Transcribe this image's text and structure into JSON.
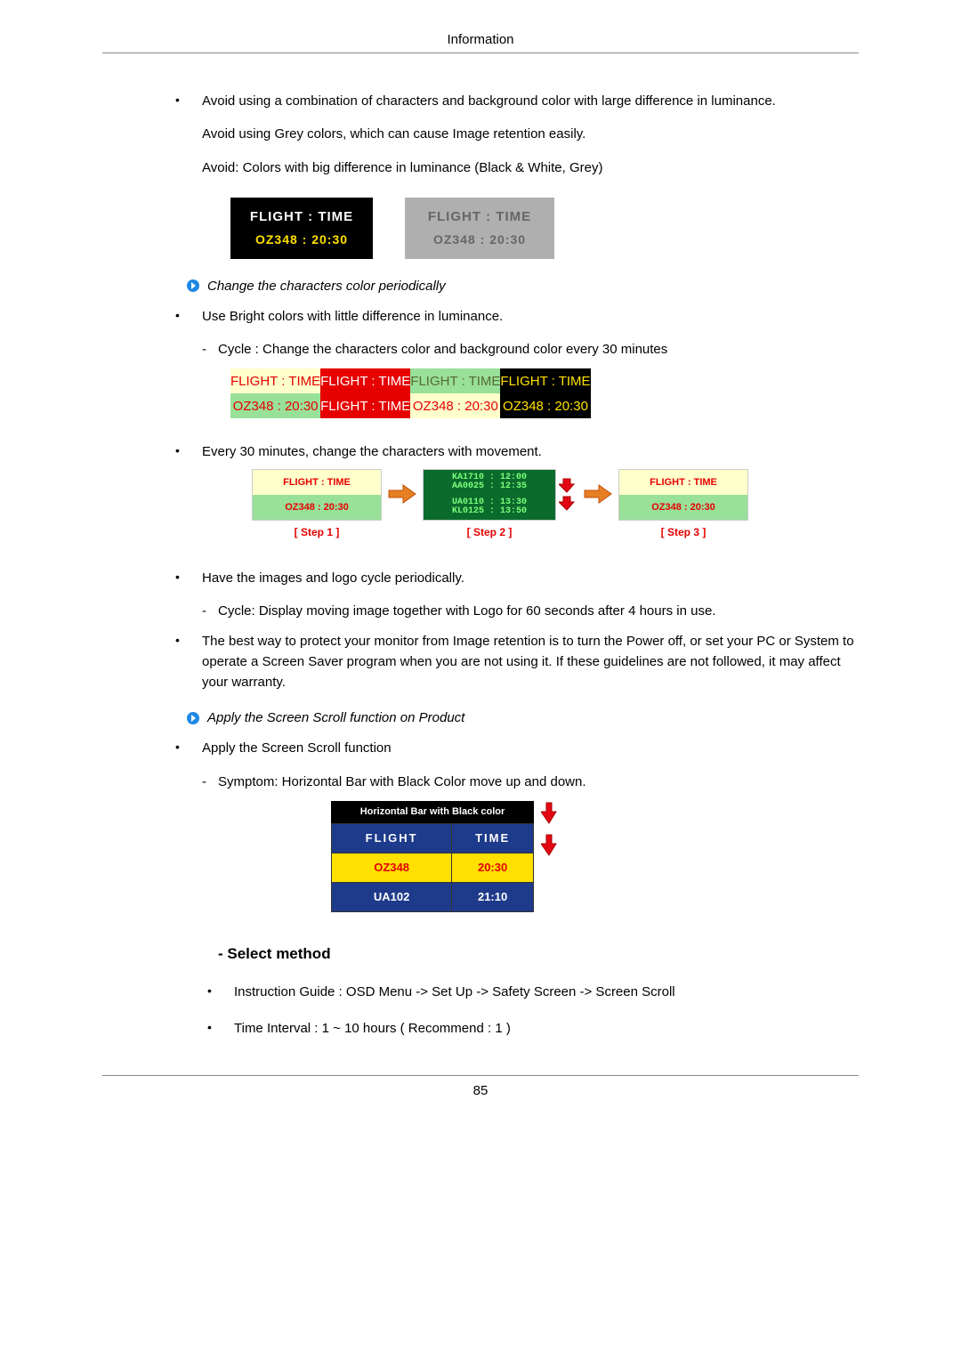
{
  "header": {
    "title": "Information"
  },
  "footer": {
    "page_number": "85"
  },
  "body": {
    "p1": "Avoid using a combination of characters and background color with large difference in luminance.",
    "p2": "Avoid using Grey colors, which can cause Image retention easily.",
    "p3": "Avoid: Colors with big difference in luminance (Black & White, Grey)",
    "fig1": {
      "a_row1": "FLIGHT : TIME",
      "a_row2": "OZ348    : 20:30",
      "b_row1": "FLIGHT : TIME",
      "b_row2": "OZ348    : 20:30"
    },
    "sec1_title": "Change the characters color periodically",
    "sec1_b1": "Use Bright colors with little difference in luminance.",
    "sec1_d1": "Cycle : Change the characters color and background color every 30 minutes",
    "fig2": {
      "cells": [
        {
          "top": "FLIGHT : TIME",
          "bottom": "OZ348    : 20:30"
        },
        {
          "top": "FLIGHT : TIME",
          "bottom": "FLIGHT : TIME"
        },
        {
          "top": "FLIGHT  :  TIME",
          "bottom": "OZ348    : 20:30"
        },
        {
          "top": "FLIGHT : TIME",
          "bottom": "OZ348    : 20:30"
        }
      ]
    },
    "sec1_b2": "Every 30 minutes, change the characters with movement.",
    "fig3": {
      "steps": [
        {
          "top": "FLIGHT  :  TIME",
          "bottom": "OZ348    : 20:30",
          "label": "[  Step 1  ]"
        },
        {
          "top": "KA1710 : 12:00\nAA0025 : 12:35",
          "bottom": "UA0110 : 13:30\nKL0125 : 13:50",
          "label": "[  Step 2  ]"
        },
        {
          "top": "FLIGHT  :  TIME",
          "bottom": "OZ348    : 20:30",
          "label": "[  Step 3  ]"
        }
      ]
    },
    "sec1_b3": "Have the images and logo cycle periodically.",
    "sec1_d2": "Cycle: Display moving image together with Logo for 60 seconds after 4 hours in use.",
    "sec1_b4": "The best way to protect your monitor from Image retention is to turn the Power off, or set your PC or System to operate a Screen Saver program when you are not using it. If these guidelines are not followed, it may affect your warranty.",
    "sec2_title": "Apply the Screen Scroll function on Product",
    "sec2_b1": "Apply the Screen Scroll function",
    "sec2_d1": "Symptom: Horizontal Bar with Black Color move up and down.",
    "fig4": {
      "bar": "Horizontal Bar with Black color",
      "header": [
        "FLIGHT",
        "TIME"
      ],
      "rows": [
        [
          "OZ348",
          "20:30"
        ],
        [
          "UA102",
          "21:10"
        ]
      ]
    },
    "select_method": {
      "heading": "- Select method",
      "items": [
        "Instruction Guide : OSD Menu -> Set Up -> Safety Screen -> Screen Scroll",
        "Time Interval : 1 ~ 10 hours ( Recommend : 1 )"
      ]
    }
  }
}
